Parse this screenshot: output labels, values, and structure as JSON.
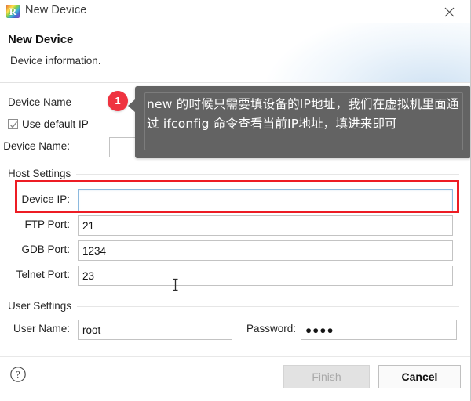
{
  "window": {
    "title": "New Device",
    "app_icon": "app-logo-icon",
    "app_icon_letter": "R",
    "close_label": "close-icon"
  },
  "header": {
    "title": "New Device",
    "subtitle": "Device information."
  },
  "groups": {
    "device_name": {
      "legend": "Device Name",
      "use_default_ip_label": "Use default IP",
      "use_default_ip_checked": true,
      "device_name_label": "Device Name:",
      "device_name_value": "",
      "device_name_placeholder": ""
    },
    "host_settings": {
      "legend": "Host Settings",
      "fields": [
        {
          "label": "Device IP:",
          "value": "",
          "focused": true
        },
        {
          "label": "FTP Port:",
          "value": "21",
          "focused": false
        },
        {
          "label": "GDB Port:",
          "value": "1234",
          "focused": false
        },
        {
          "label": "Telnet Port:",
          "value": "23",
          "focused": false
        }
      ]
    },
    "user_settings": {
      "legend": "User Settings",
      "user_name_label": "User Name:",
      "user_name_value": "root",
      "password_label": "Password:",
      "password_value": "●●●●"
    }
  },
  "annotation": {
    "badge_number": "1",
    "tooltip_text": "new 的时候只需要填设备的IP地址，我们在虚拟机里面通过 ifconfig 命令查看当前IP地址，填进来即可",
    "highlight_color": "#ed1c24",
    "badge_color": "#ef3340",
    "tooltip_bg": "#636363"
  },
  "footer": {
    "help_label": "help-icon",
    "finish_label": "Finish",
    "finish_enabled": false,
    "cancel_label": "Cancel"
  }
}
